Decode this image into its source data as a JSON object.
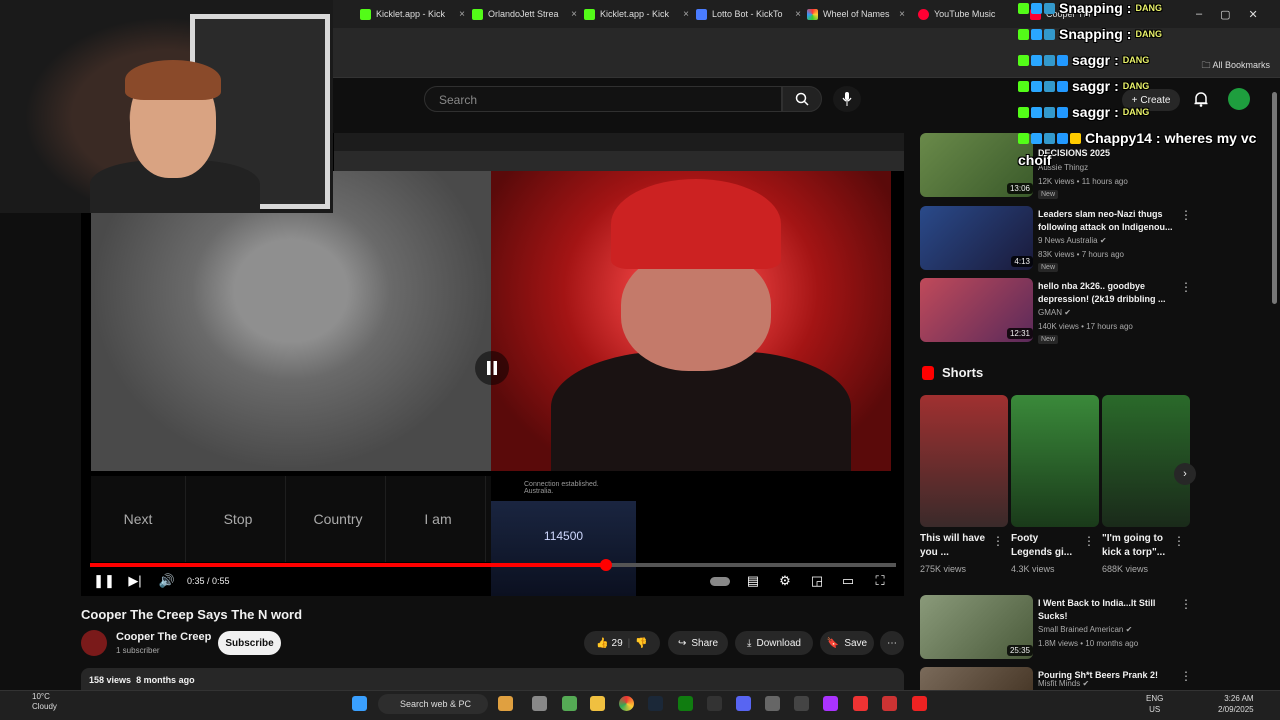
{
  "tabs": [
    {
      "label": "Kicklet.app - Kick",
      "color": "#53fc18"
    },
    {
      "label": "OrlandoJett Strea",
      "color": "#53fc18"
    },
    {
      "label": "Kicklet.app - Kick",
      "color": "#53fc18"
    },
    {
      "label": "Lotto Bot - KickTo",
      "color": "#4a7cff"
    },
    {
      "label": "Wheel of Names",
      "color": "#ffffff"
    },
    {
      "label": "YouTube Music",
      "color": "#ff0033"
    },
    {
      "label": "Cooper The",
      "color": "#ff0033"
    }
  ],
  "bookmarks": {
    "all": "All Bookmarks"
  },
  "header": {
    "search_placeholder": "Search",
    "create": "Create"
  },
  "player": {
    "omegle_buttons": [
      "Next",
      "Stop",
      "Country",
      "I am"
    ],
    "connection_line1": "Connection established.",
    "connection_line2": "Australia.",
    "mini_readout": "114500",
    "time": "0:35 / 0:55",
    "progress": 0.64
  },
  "video": {
    "title": "Cooper The Creep Says The N word",
    "channel": "Cooper The Creep",
    "subscribers": "1 subscriber",
    "subscribe": "Subscribe",
    "likes": "29",
    "share": "Share",
    "download": "Download",
    "save": "Save",
    "views": "158 views",
    "age": "8 months ago"
  },
  "recommended": [
    {
      "title": "DECISIONS 2025",
      "channel": "Aussie Thingz",
      "meta": "12K views • 11 hours ago",
      "badge": "New",
      "duration": "13:06",
      "color": "#5a7a3a"
    },
    {
      "title": "Leaders slam neo-Nazi thugs following attack on Indigenou...",
      "channel": "9 News Australia",
      "meta": "83K views • 7 hours ago",
      "badge": "New",
      "duration": "4:13",
      "color": "#2a4a8a"
    },
    {
      "title": "hello nba 2k26.. goodbye depression! (2k19 dribbling ...",
      "channel": "GMAN",
      "meta": "140K views • 17 hours ago",
      "badge": "New",
      "duration": "12:31",
      "color": "#a03a4a"
    },
    {
      "title": "I Went Back to India...It Still Sucks!",
      "channel": "Small Brained American",
      "meta": "1.8M views • 10 months ago",
      "badge": "",
      "duration": "25:35",
      "color": "#6a7a5a"
    },
    {
      "title": "Pouring Sh*t Beers Prank 2!",
      "channel": "Misfit Minds",
      "meta": "",
      "badge": "",
      "duration": "",
      "color": "#5a4a3a"
    }
  ],
  "shorts": {
    "title": "Shorts",
    "items": [
      {
        "title": "This will have you ...",
        "views": "275K views",
        "color": "#8a3a3a"
      },
      {
        "title": "Footy Legends gi...",
        "views": "4.3K views",
        "color": "#3a7a3a"
      },
      {
        "title": "\"I'm going to kick a torp\"...",
        "views": "688K views",
        "color": "#2a5a2a"
      }
    ]
  },
  "chat": [
    {
      "user": "Snapping",
      "msg": "",
      "emote": "DANG"
    },
    {
      "user": "Snapping",
      "msg": "",
      "emote": "DANG"
    },
    {
      "user": "saggr",
      "msg": "",
      "emote": "DANG"
    },
    {
      "user": "saggr",
      "msg": "",
      "emote": "DANG"
    },
    {
      "user": "saggr",
      "msg": "",
      "emote": "DANG"
    },
    {
      "user": "Chappy14",
      "msg": "wheres my vc",
      "emote": ""
    },
    {
      "user": "",
      "msg": "choif",
      "emote": ""
    }
  ],
  "taskbar": {
    "temp": "10°C",
    "weather": "Cloudy",
    "search": "Search web & PC",
    "lang1": "ENG",
    "lang2": "US",
    "time": "3:26 AM",
    "date": "2/09/2025"
  }
}
